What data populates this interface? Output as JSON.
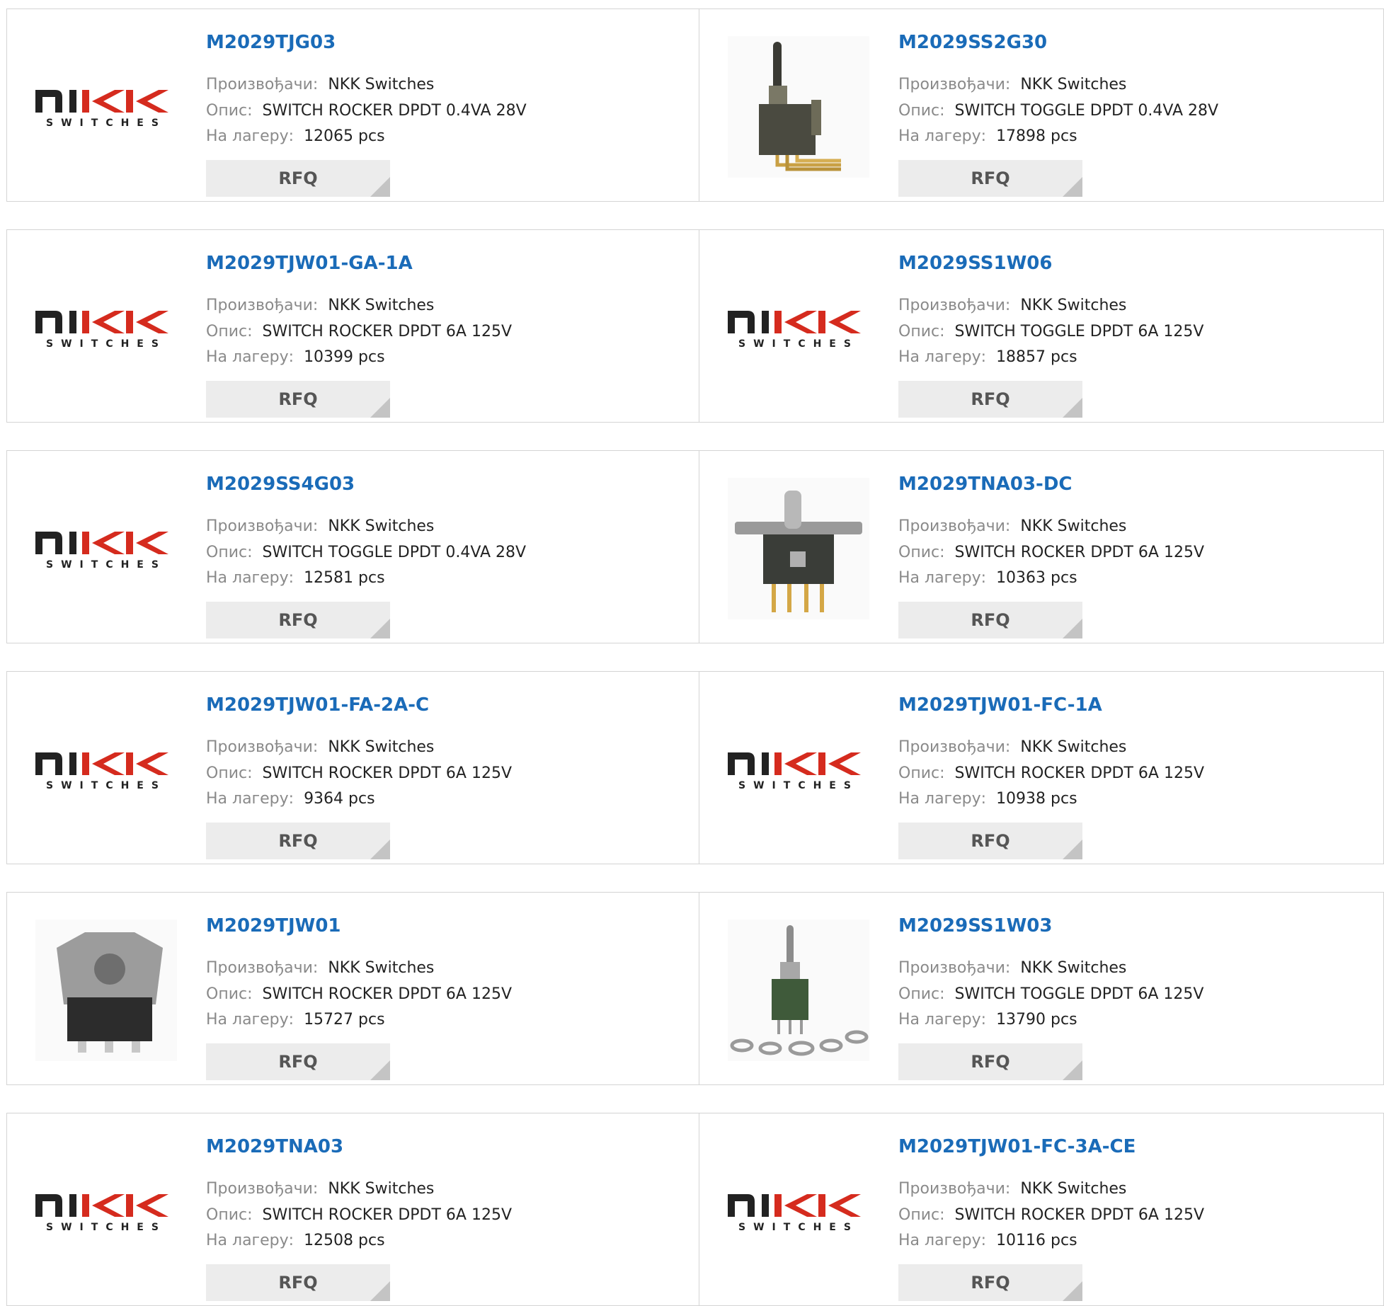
{
  "labels": {
    "manufacturer": "Произвођачи:",
    "description": "Опис:",
    "stock": "На лагеру:",
    "rfq": "RFQ"
  },
  "logo": {
    "top": "nIKK",
    "bottom": "SWITCHES"
  },
  "rows": [
    {
      "left": {
        "part": "M2029TJG03",
        "manufacturer": "NKK Switches",
        "description": "SWITCH ROCKER DPDT 0.4VA 28V",
        "stock": "12065 pcs",
        "image": "nkk-logo"
      },
      "right": {
        "part": "M2029SS2G30",
        "manufacturer": "NKK Switches",
        "description": "SWITCH TOGGLE DPDT 0.4VA 28V",
        "stock": "17898 pcs",
        "image": "toggle-right-angle-photo"
      }
    },
    {
      "left": {
        "part": "M2029TJW01-GA-1A",
        "manufacturer": "NKK Switches",
        "description": "SWITCH ROCKER DPDT 6A 125V",
        "stock": "10399 pcs",
        "image": "nkk-logo"
      },
      "right": {
        "part": "M2029SS1W06",
        "manufacturer": "NKK Switches",
        "description": "SWITCH TOGGLE DPDT 6A 125V",
        "stock": "18857 pcs",
        "image": "nkk-logo"
      }
    },
    {
      "left": {
        "part": "M2029SS4G03",
        "manufacturer": "NKK Switches",
        "description": "SWITCH TOGGLE DPDT 0.4VA 28V",
        "stock": "12581 pcs",
        "image": "nkk-logo"
      },
      "right": {
        "part": "M2029TNA03-DC",
        "manufacturer": "NKK Switches",
        "description": "SWITCH ROCKER DPDT 6A 125V",
        "stock": "10363 pcs",
        "image": "rocker-bracket-photo"
      }
    },
    {
      "left": {
        "part": "M2029TJW01-FA-2A-C",
        "manufacturer": "NKK Switches",
        "description": "SWITCH ROCKER DPDT 6A 125V",
        "stock": "9364 pcs",
        "image": "nkk-logo"
      },
      "right": {
        "part": "M2029TJW01-FC-1A",
        "manufacturer": "NKK Switches",
        "description": "SWITCH ROCKER DPDT 6A 125V",
        "stock": "10938 pcs",
        "image": "nkk-logo"
      }
    },
    {
      "left": {
        "part": "M2029TJW01",
        "manufacturer": "NKK Switches",
        "description": "SWITCH ROCKER DPDT 6A 125V",
        "stock": "15727 pcs",
        "image": "rocker-guard-photo"
      },
      "right": {
        "part": "M2029SS1W03",
        "manufacturer": "NKK Switches",
        "description": "SWITCH TOGGLE DPDT 6A 125V",
        "stock": "13790 pcs",
        "image": "toggle-washers-photo"
      }
    },
    {
      "left": {
        "part": "M2029TNA03",
        "manufacturer": "NKK Switches",
        "description": "SWITCH ROCKER DPDT 6A 125V",
        "stock": "12508 pcs",
        "image": "nkk-logo"
      },
      "right": {
        "part": "M2029TJW01-FC-3A-CE",
        "manufacturer": "NKK Switches",
        "description": "SWITCH ROCKER DPDT 6A 125V",
        "stock": "10116 pcs",
        "image": "nkk-logo"
      }
    }
  ]
}
